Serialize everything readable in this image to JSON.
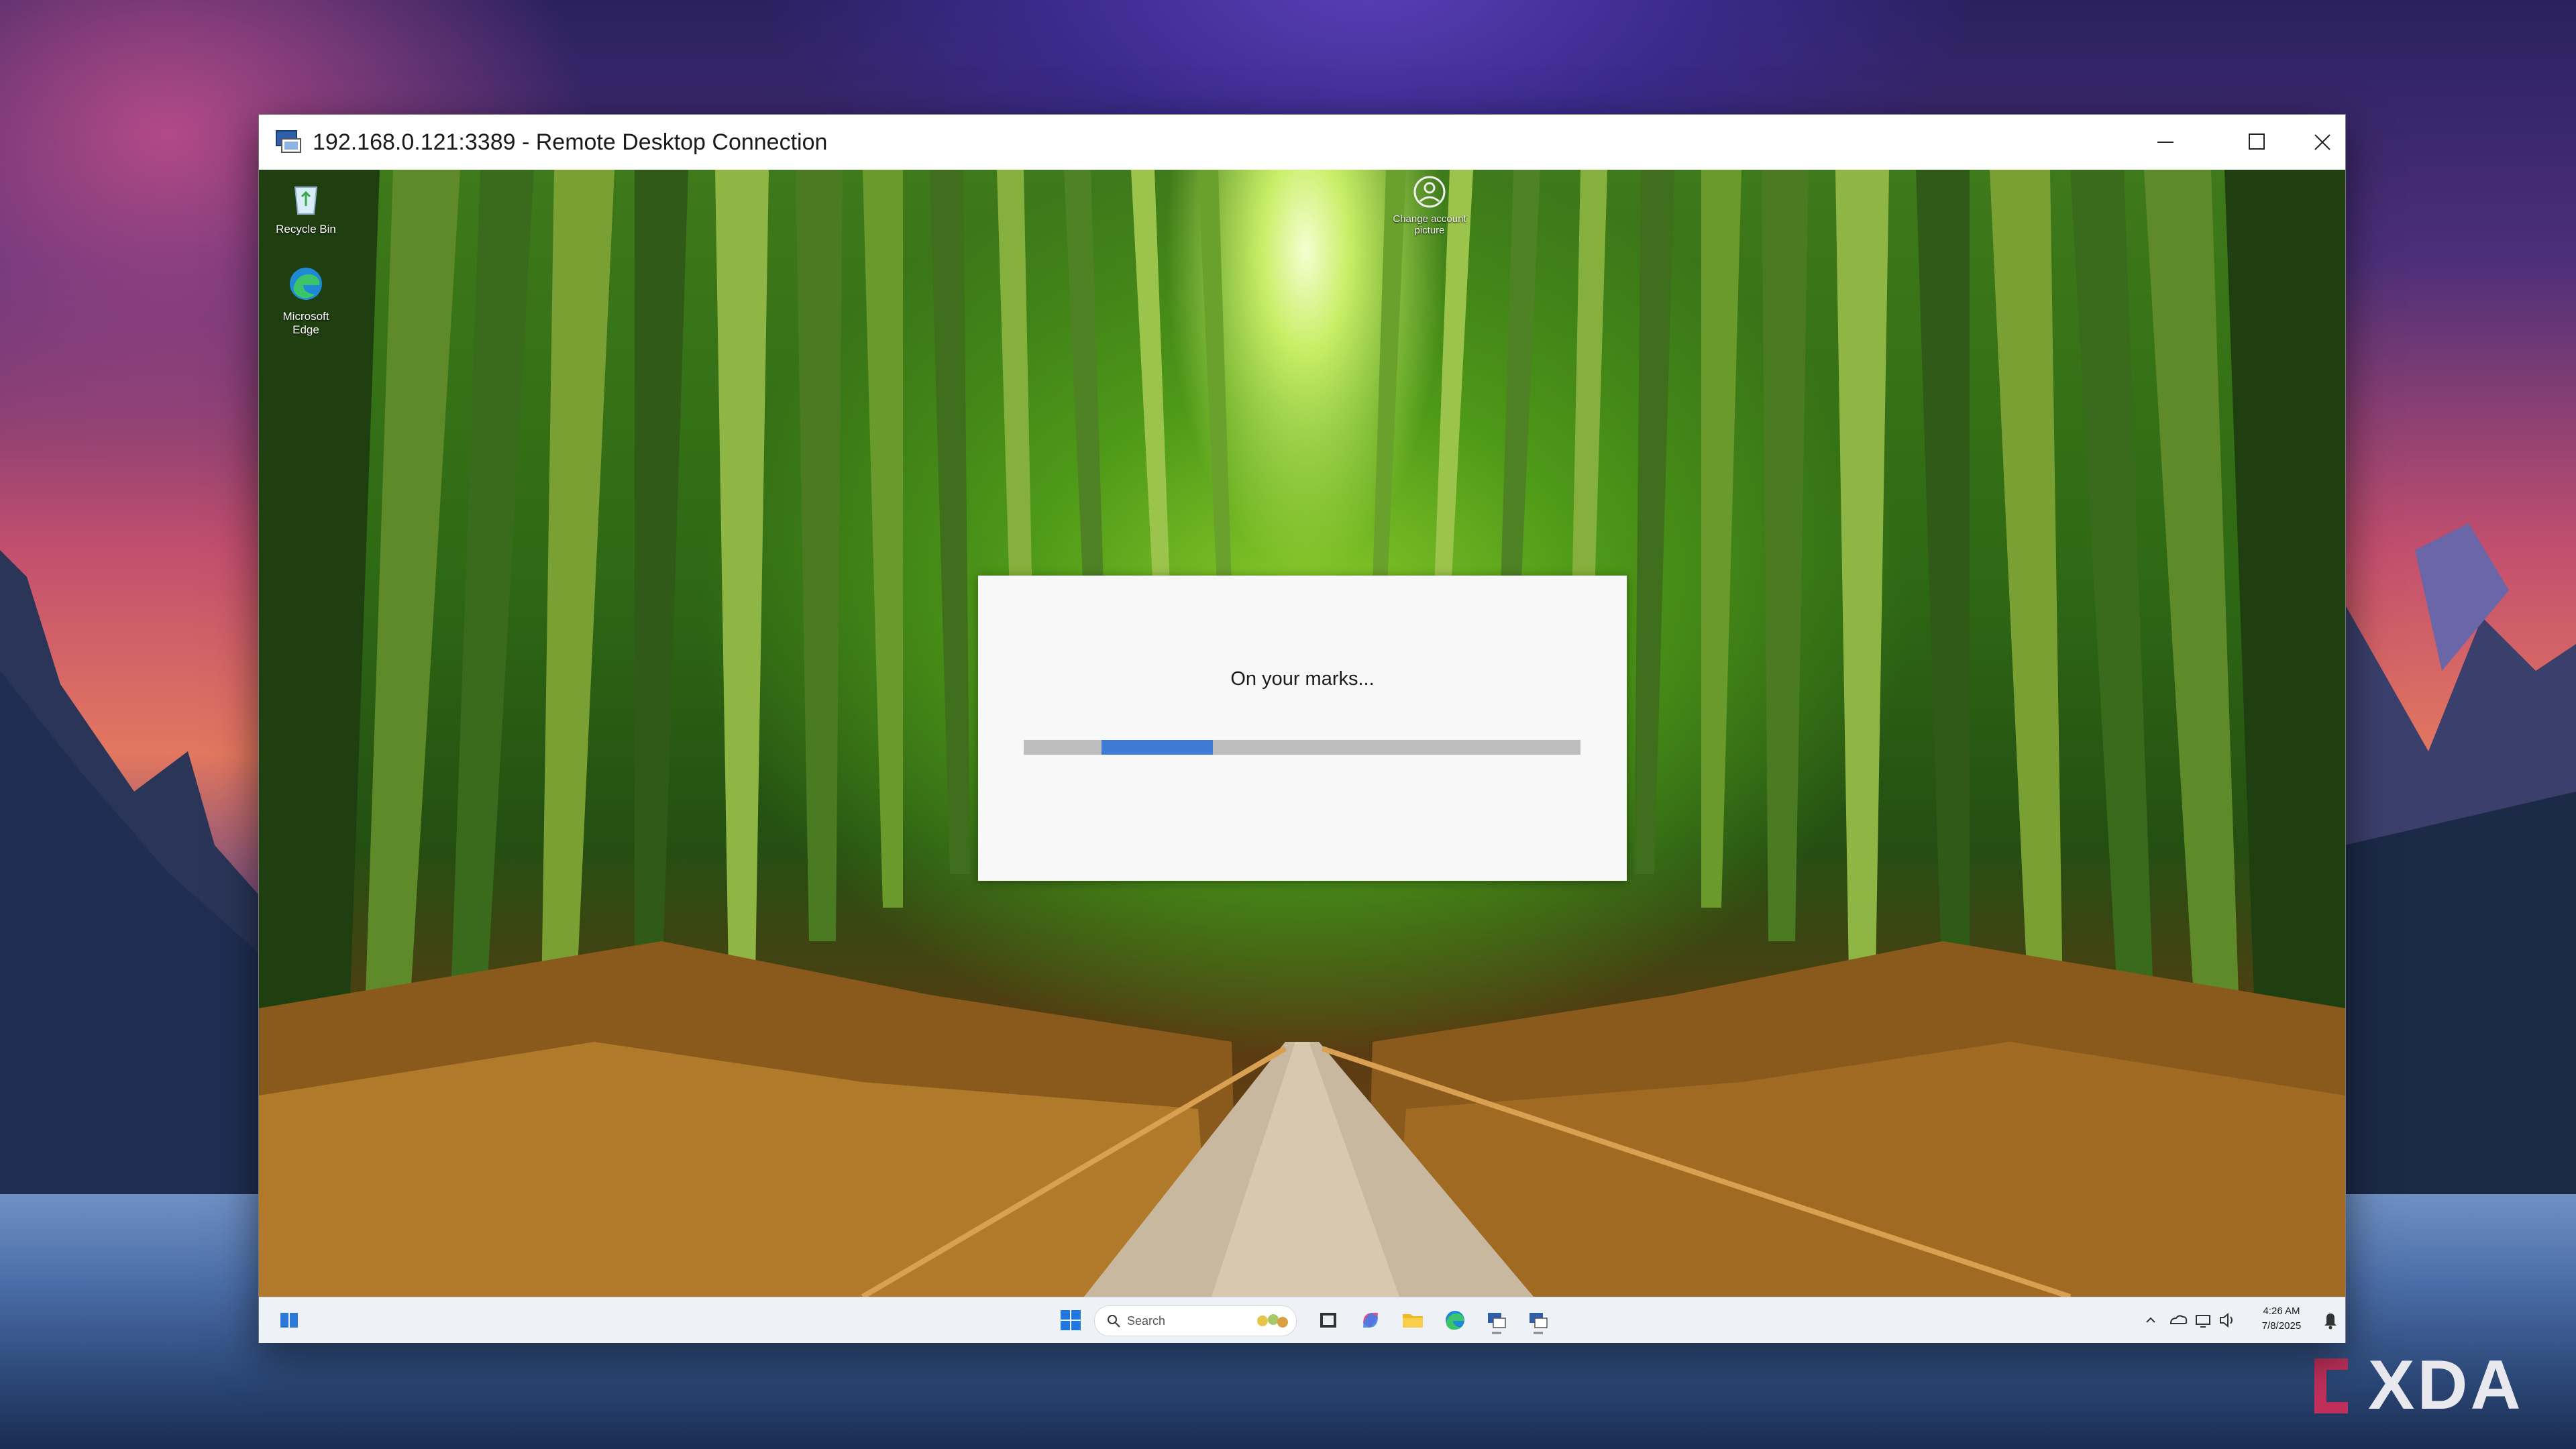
{
  "window": {
    "title": "192.168.0.121:3389 - Remote Desktop Connection"
  },
  "desktop_icons": {
    "recycle_bin": "Recycle Bin",
    "edge": "Microsoft Edge",
    "account": "Change account picture"
  },
  "dialog": {
    "message": "On your marks...",
    "progress_segment_start": 0.14,
    "progress_segment_width": 0.2
  },
  "taskbar": {
    "search_label": "Search",
    "time": "4:26 AM",
    "date": "7/8/2025",
    "icons": [
      "widgets-icon",
      "start-icon",
      "search-icon",
      "task-view-icon",
      "copilot-icon",
      "file-explorer-icon",
      "edge-icon",
      "remote-desktop-icon",
      "remote-desktop-icon",
      "chevron-up-icon",
      "onedrive-icon",
      "network-icon",
      "volume-icon",
      "notification-bell-icon"
    ]
  },
  "watermark": {
    "text": "XDA"
  },
  "colors": {
    "progress_accent": "#3e7ad6",
    "taskbar_bg": "#eef1f5"
  }
}
